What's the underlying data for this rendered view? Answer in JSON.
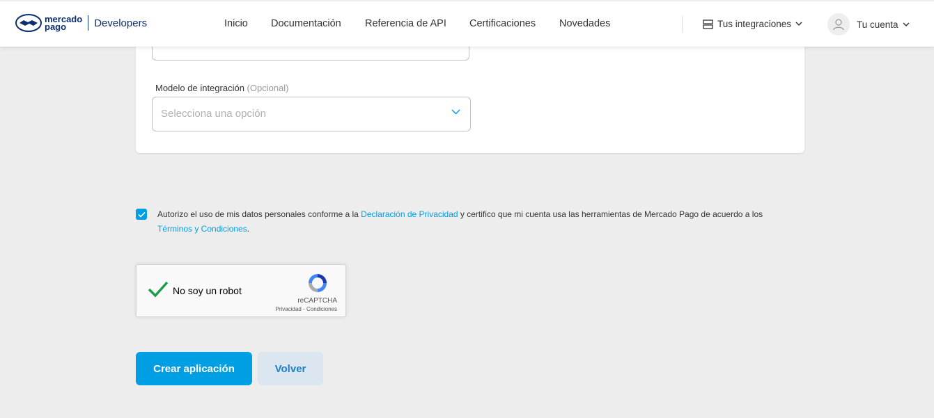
{
  "header": {
    "logo_line1": "mercado",
    "logo_line2": "pago",
    "logo_product": "Developers",
    "nav": [
      "Inicio",
      "Documentación",
      "Referencia de API",
      "Certificaciones",
      "Novedades"
    ],
    "integrations_label": "Tus integraciones",
    "account_label": "Tu cuenta"
  },
  "form": {
    "integration_model_label": "Modelo de integración",
    "integration_model_optional": "(Opcional)",
    "integration_model_placeholder": "Selecciona una opción"
  },
  "consent": {
    "checked": true,
    "text_1": "Autorizo el uso de mis datos personales conforme a la ",
    "link_privacy": "Declaración de Privacidad",
    "text_2": " y certifico que mi cuenta usa las herramientas de Mercado Pago de acuerdo a los ",
    "link_terms": "Términos y Condiciones",
    "text_3": "."
  },
  "recaptcha": {
    "label": "No soy un robot",
    "brand": "reCAPTCHA",
    "terms": "Privacidad - Condiciones",
    "checked": true
  },
  "actions": {
    "create_label": "Crear aplicación",
    "back_label": "Volver"
  },
  "colors": {
    "accent": "#009ee3",
    "brand_dark": "#0b2e6e",
    "check_green": "#1a9c4b"
  }
}
